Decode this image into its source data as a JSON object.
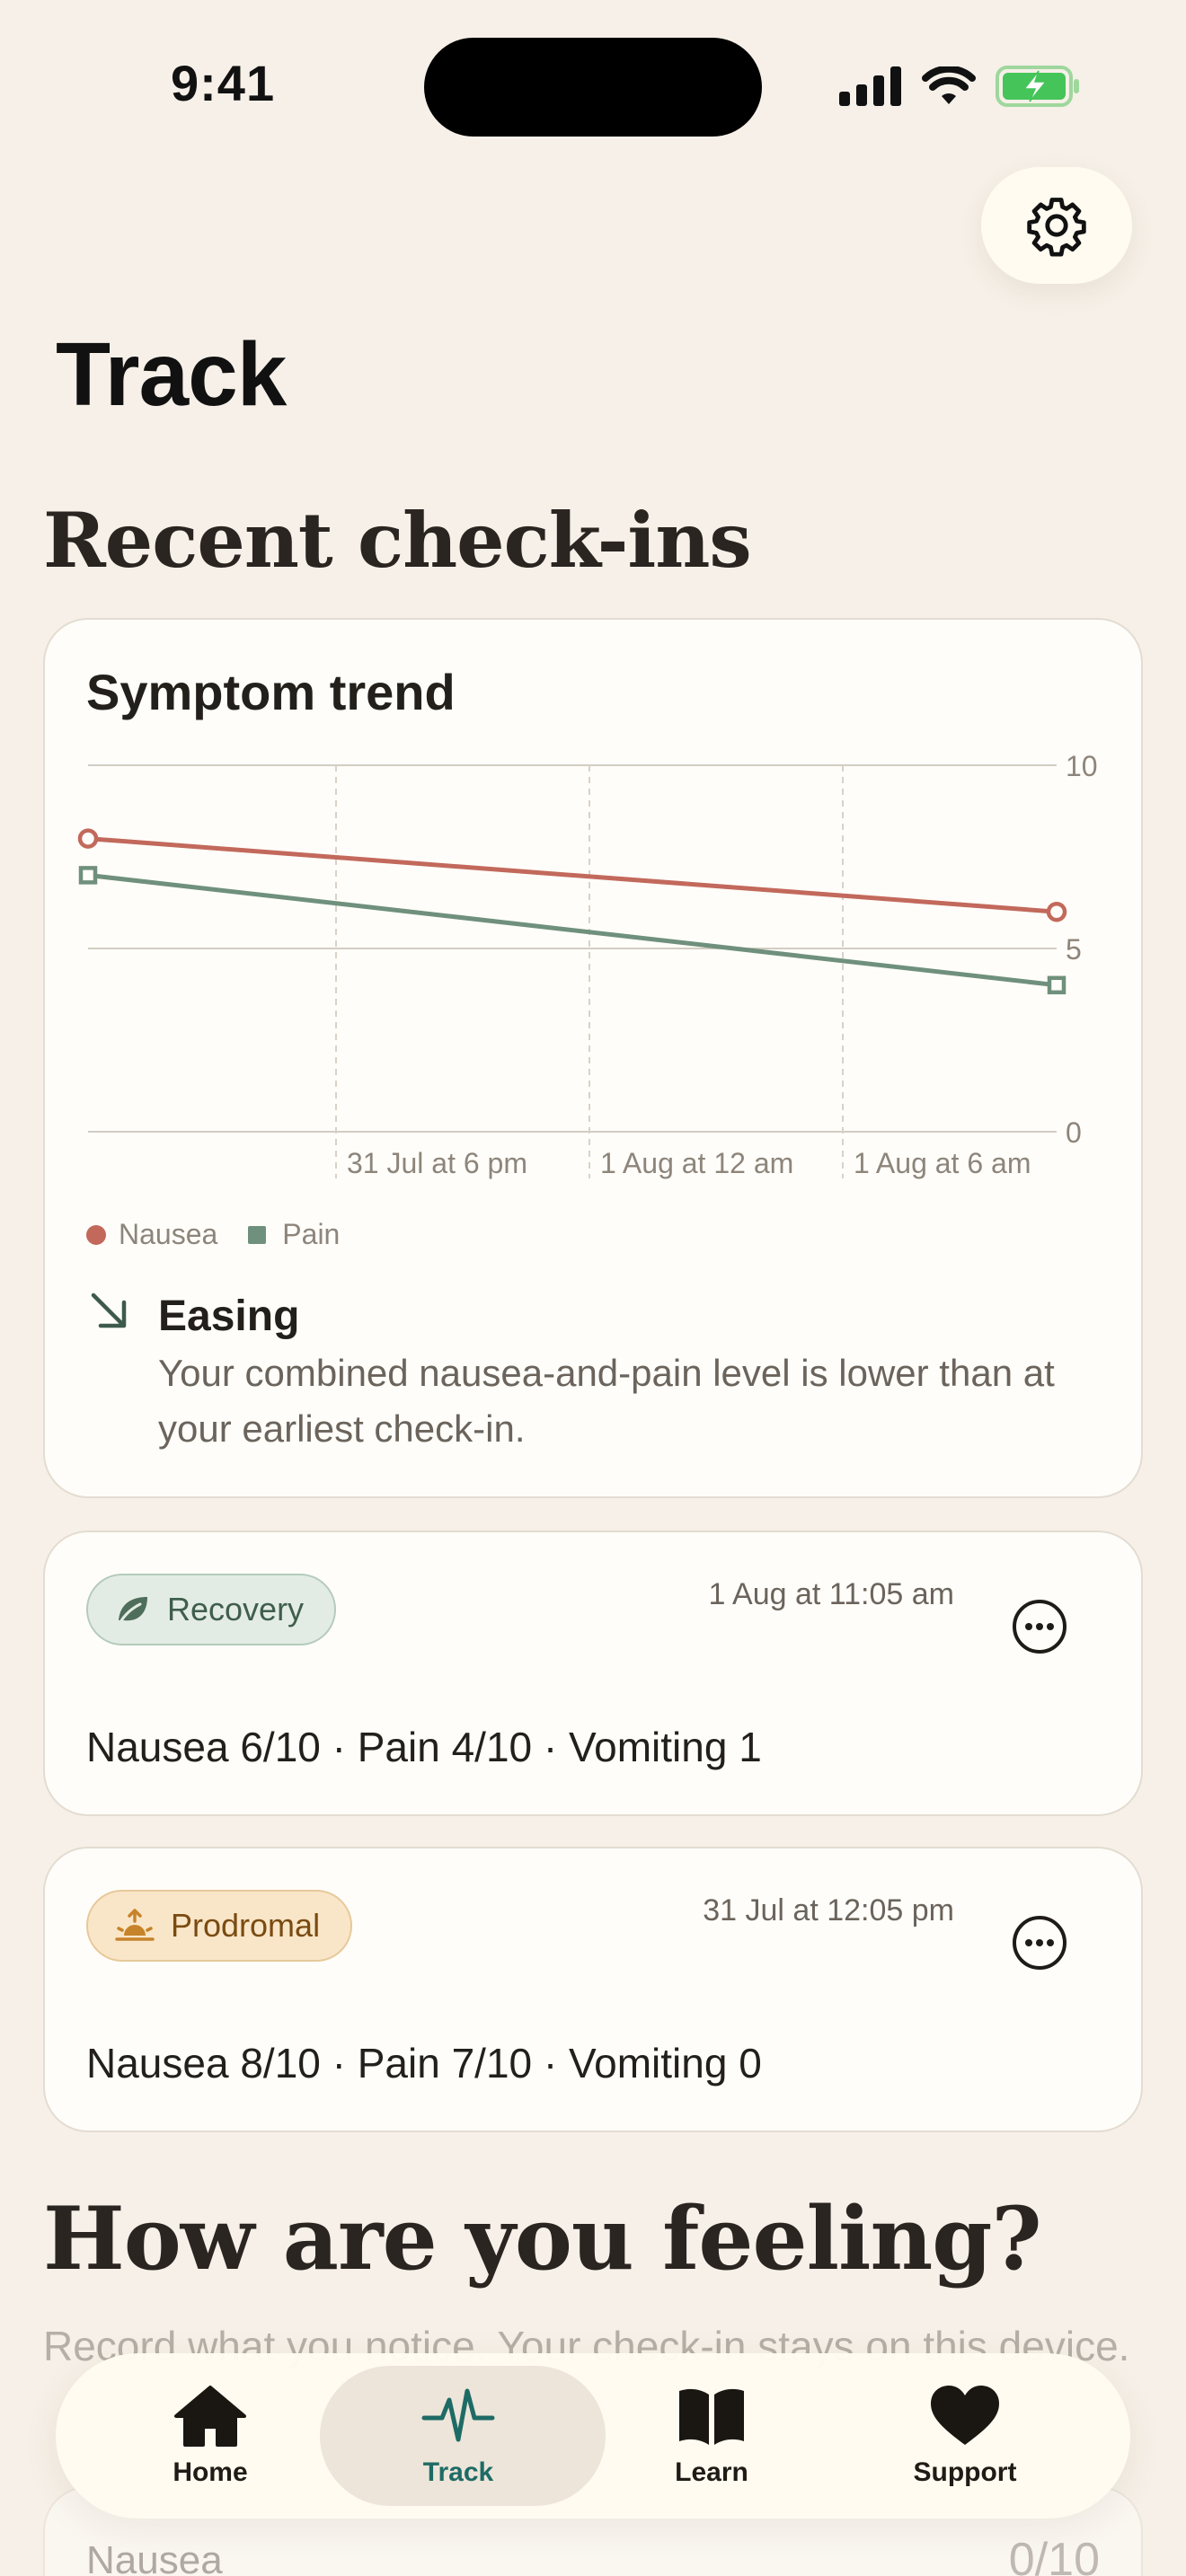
{
  "status_bar": {
    "time": "9:41"
  },
  "header": {
    "title": "Track",
    "settings_icon": "gear-icon"
  },
  "recent": {
    "title": "Recent check-ins",
    "trend_card": {
      "title": "Symptom trend",
      "legend": {
        "nausea": "Nausea",
        "pain": "Pain"
      },
      "trend_label": "Easing",
      "trend_icon": "arrow-down-right-icon",
      "trend_description": "Your combined nausea-and-pain level is lower than at your earliest check-in."
    },
    "entries": [
      {
        "phase": "Recovery",
        "phase_icon": "leaf-icon",
        "timestamp": "1 Aug at 11:05 am",
        "summary": "Nausea 6/10 · Pain 4/10 · Vomiting 1"
      },
      {
        "phase": "Prodromal",
        "phase_icon": "sunrise-icon",
        "timestamp": "31 Jul at 12:05 pm",
        "summary": "Nausea 8/10 · Pain 7/10 · Vomiting 0"
      }
    ]
  },
  "feeling": {
    "title": "How are you feeling?",
    "intro": "Record what you notice. Your check-in stays on this device.",
    "nausea_label": "Nausea",
    "nausea_value": "0/10"
  },
  "tabs": [
    {
      "label": "Home",
      "icon": "home-icon",
      "active": false
    },
    {
      "label": "Track",
      "icon": "pulse-icon",
      "active": true
    },
    {
      "label": "Learn",
      "icon": "book-icon",
      "active": false
    },
    {
      "label": "Support",
      "icon": "heart-icon",
      "active": false
    }
  ],
  "colors": {
    "nausea": "#c2695c",
    "pain": "#6f907c",
    "accent": "#1e6b66",
    "background": "#f6f0e8"
  },
  "chart_data": {
    "type": "line",
    "title": "Symptom trend",
    "x_ticks": [
      "31 Jul at 6 pm",
      "1 Aug at 12 am",
      "1 Aug at 6 am"
    ],
    "x": [
      "31 Jul at 12:05 pm",
      "1 Aug at 11:05 am"
    ],
    "series": [
      {
        "name": "Nausea",
        "values": [
          8,
          6
        ],
        "color": "#c2695c",
        "marker": "circle"
      },
      {
        "name": "Pain",
        "values": [
          7,
          4
        ],
        "color": "#6f907c",
        "marker": "square"
      }
    ],
    "yticks": [
      0,
      5,
      10
    ],
    "ylim": [
      0,
      10
    ],
    "grid": true,
    "legend": "bottom-left"
  }
}
